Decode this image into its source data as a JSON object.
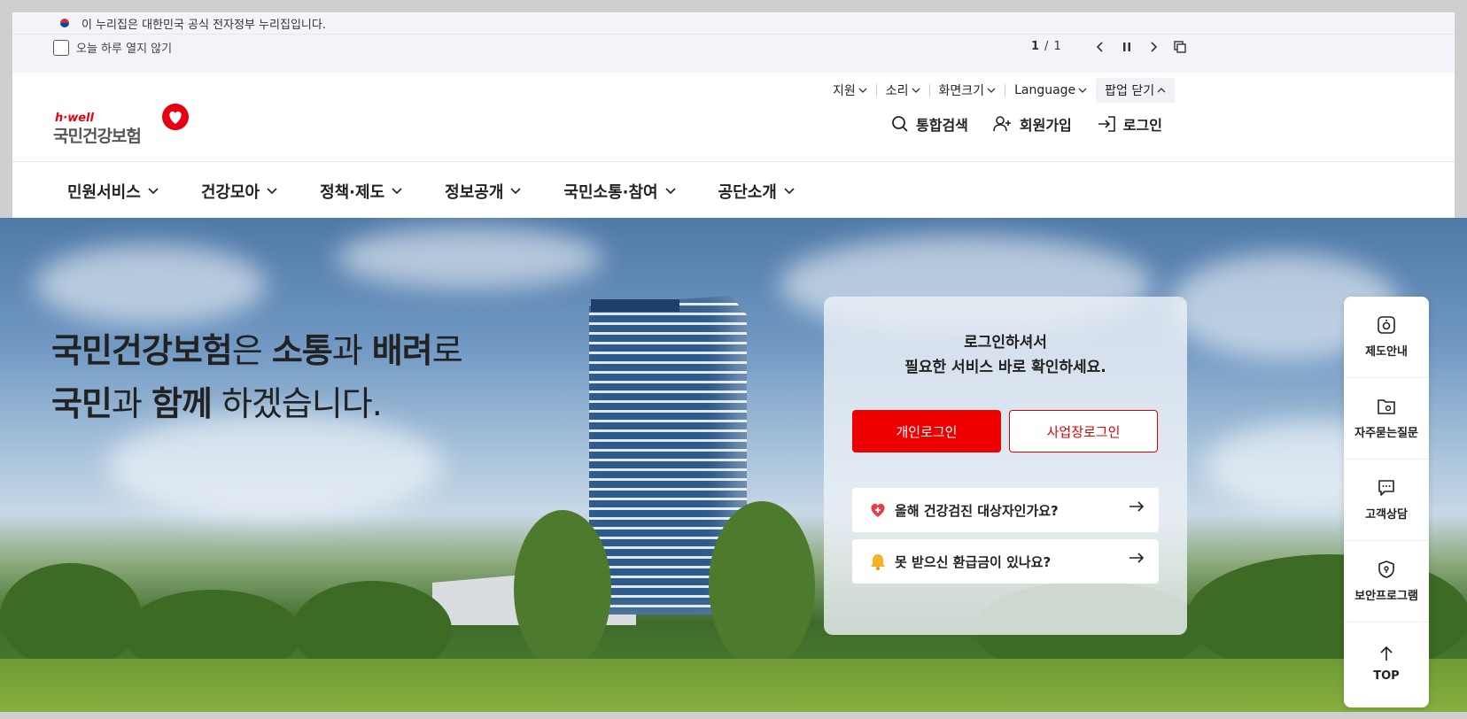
{
  "gov_banner": {
    "text": "이 누리집은 대한민국 공식 전자정부 누리집입니다."
  },
  "popup_bar": {
    "checkbox_label": "오늘 하루 열지 않기",
    "page_current": "1",
    "page_separator": "/",
    "page_total": "1"
  },
  "utility": {
    "support": "지원",
    "sound": "소리",
    "screen_size": "화면크기",
    "language": "Language",
    "popup_close": "팝업 닫기"
  },
  "logo": {
    "tagline": "h·well",
    "name": "국민건강보험"
  },
  "header_links": {
    "search": "통합검색",
    "signup": "회원가입",
    "login": "로그인"
  },
  "nav": {
    "items": [
      "민원서비스",
      "건강모아",
      "정책·제도",
      "정보공개",
      "국민소통·참여",
      "공단소개"
    ]
  },
  "hero": {
    "line1_b1": "국민건강보험",
    "line1_t1": "은 ",
    "line1_b2": "소통",
    "line1_t2": "과 ",
    "line1_b3": "배려",
    "line1_t3": "로",
    "line2_b1": "국민",
    "line2_t1": "과 ",
    "line2_b2": "함께",
    "line2_t2": " 하겠습니다."
  },
  "login_card": {
    "message_line1": "로그인하셔서",
    "message_line2": "필요한 서비스 바로 확인하세요.",
    "personal_login": "개인로그인",
    "business_login": "사업장로그인",
    "checkup_question": "올해 건강검진 대상자인가요?",
    "refund_question": "못 받으신 환급금이 있나요?"
  },
  "quick_menu": {
    "guide": "제도안내",
    "faq": "자주묻는질문",
    "counsel": "고객상담",
    "security": "보안프로그램",
    "top": "TOP"
  },
  "colors": {
    "brand_red": "#ee0000",
    "text_dark": "#222222"
  }
}
